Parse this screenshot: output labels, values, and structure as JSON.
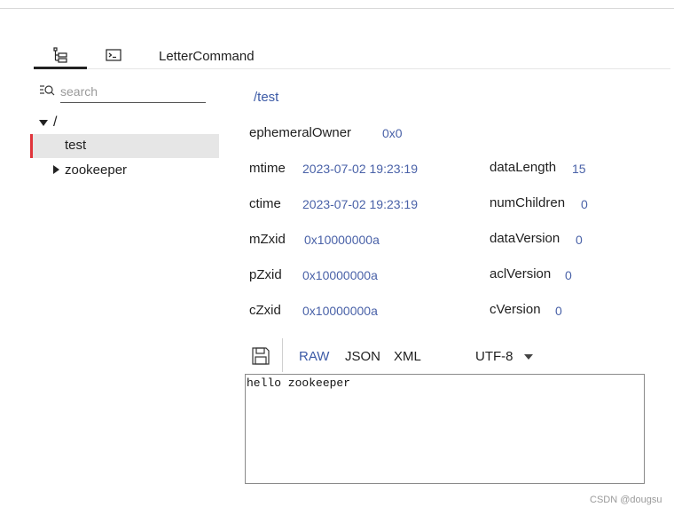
{
  "tabs": {
    "tree_icon": "tree-icon",
    "terminal_icon": "terminal-icon",
    "command_label": "LetterCommand"
  },
  "search": {
    "placeholder": "search",
    "value": ""
  },
  "tree": {
    "root": "/",
    "selected": "test",
    "child": "zookeeper",
    "selected_marker_color": "#e0353b"
  },
  "node": {
    "path": "/test",
    "ephemeralOwner": {
      "label": "ephemeralOwner",
      "value": "0x0"
    },
    "mtime": {
      "label": "mtime",
      "value": "2023-07-02 19:23:19"
    },
    "ctime": {
      "label": "ctime",
      "value": "2023-07-02 19:23:19"
    },
    "mZxid": {
      "label": "mZxid",
      "value": "0x10000000a"
    },
    "pZxid": {
      "label": "pZxid",
      "value": "0x10000000a"
    },
    "cZxid": {
      "label": "cZxid",
      "value": "0x10000000a"
    },
    "dataLength": {
      "label": "dataLength",
      "value": "15"
    },
    "numChildren": {
      "label": "numChildren",
      "value": "0"
    },
    "dataVersion": {
      "label": "dataVersion",
      "value": "0"
    },
    "aclVersion": {
      "label": "aclVersion",
      "value": "0"
    },
    "cVersion": {
      "label": "cVersion",
      "value": "0"
    }
  },
  "toolbar": {
    "formats": [
      "RAW",
      "JSON",
      "XML"
    ],
    "active_format": "RAW",
    "encoding": "UTF-8"
  },
  "editor": {
    "content": "hello zookeeper"
  },
  "watermark": "CSDN @dougsu",
  "colors": {
    "accent": "#3c5aa6",
    "value_text": "#4a62a8",
    "selected_bg": "#e6e6e6"
  }
}
